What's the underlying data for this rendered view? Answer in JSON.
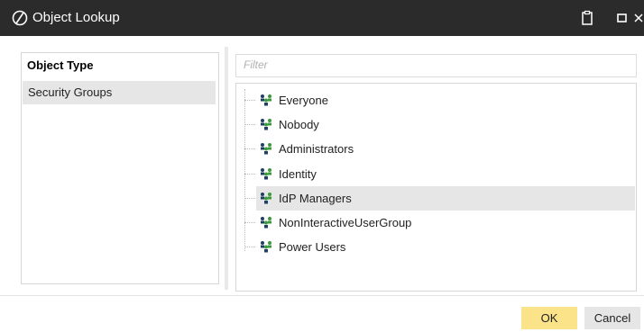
{
  "window": {
    "title": "Object Lookup"
  },
  "left_panel": {
    "header": "Object Type",
    "items": [
      {
        "label": "Security Groups",
        "selected": true
      }
    ]
  },
  "filter": {
    "placeholder": "Filter",
    "value": ""
  },
  "tree": {
    "items": [
      {
        "label": "Everyone",
        "icon": "group-icon",
        "selected": false
      },
      {
        "label": "Nobody",
        "icon": "group-icon",
        "selected": false
      },
      {
        "label": "Administrators",
        "icon": "group-icon",
        "selected": false
      },
      {
        "label": "Identity",
        "icon": "group-icon",
        "selected": false
      },
      {
        "label": "IdP Managers",
        "icon": "group-icon",
        "selected": true
      },
      {
        "label": "NonInteractiveUserGroup",
        "icon": "group-icon",
        "selected": false
      },
      {
        "label": "Power Users",
        "icon": "group-icon",
        "selected": false
      }
    ]
  },
  "buttons": {
    "ok_label": "OK",
    "cancel_label": "Cancel"
  },
  "colors": {
    "titlebar": "#2b2b2b",
    "ok_button": "#fbe38a",
    "selection": "#e6e6e6",
    "icon_green": "#3a9a3a",
    "icon_dark": "#1f3f66"
  }
}
